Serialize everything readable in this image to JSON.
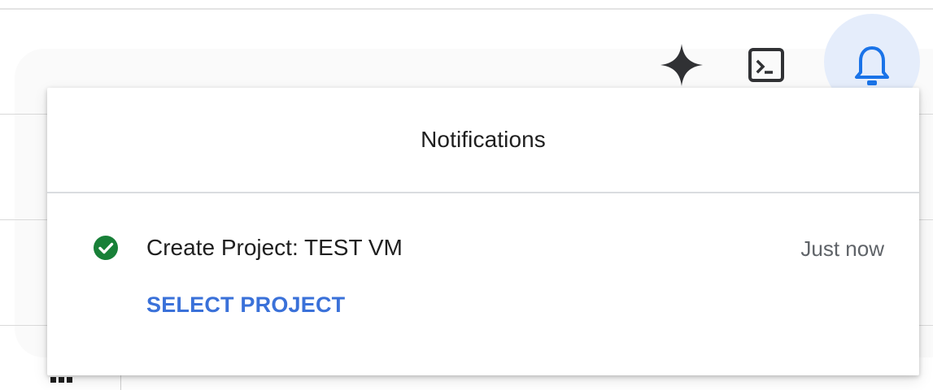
{
  "toolbar": {
    "gemini_icon": "gemini-sparkle-icon",
    "shell_icon": "cloud-shell-icon",
    "bell_icon": "bell-icon",
    "bell_active_bg": "#e5edfb",
    "bell_color": "#1a73e8"
  },
  "notifications": {
    "title": "Notifications",
    "items": [
      {
        "status": "success",
        "status_icon": "check-circle-icon",
        "status_color": "#188038",
        "title": "Create Project: TEST VM",
        "time": "Just now",
        "action_label": "SELECT PROJECT",
        "action_color": "#3a71d9"
      }
    ]
  },
  "background": {
    "apps_icon": "apps-grid-icon"
  }
}
